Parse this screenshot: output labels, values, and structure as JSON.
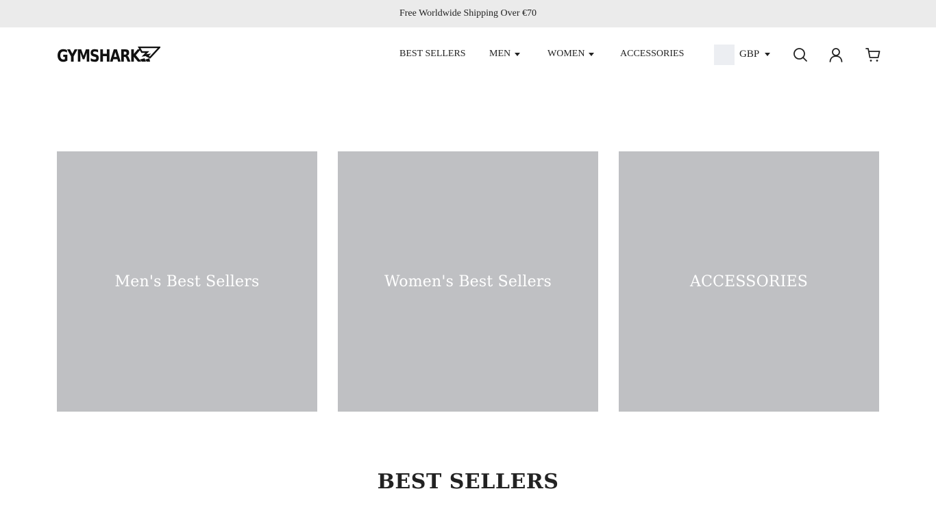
{
  "announcement": {
    "text": "Free Worldwide Shipping Over €70"
  },
  "header": {
    "logo_text": "GYMSHARK",
    "logo_icon": "shark-logo-icon",
    "nav": {
      "best_sellers": "BEST SELLERS",
      "men": "MEN",
      "women": "WOMEN",
      "accessories": "ACCESSORIES"
    },
    "currency": "GBP",
    "icons": {
      "search": "search-icon",
      "account": "user-icon",
      "cart": "cart-icon"
    }
  },
  "tiles": [
    {
      "label": "Men's Best Sellers"
    },
    {
      "label": "Women's Best Sellers"
    },
    {
      "label": "ACCESSORIES"
    }
  ],
  "sections": {
    "best_sellers_title": "BEST SELLERS"
  },
  "colors": {
    "announcement_bg": "#ebebeb",
    "tile_bg": "#bfc0c3",
    "text": "#222222"
  }
}
